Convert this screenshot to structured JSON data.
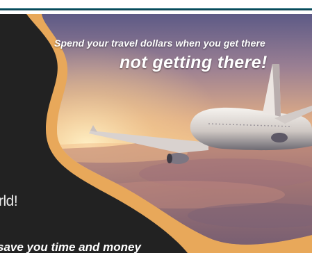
{
  "banner": {
    "headline_line1": "Spend your travel dollars when you get there",
    "headline_line2": "not getting there!",
    "left_text_1": "rld!",
    "left_text_2": "save you time and money",
    "image": "airplane-above-clouds-at-sunset",
    "colors": {
      "background": "#222222",
      "accent_swoosh": "#e8a85a",
      "top_border": "#0a4a5a"
    }
  }
}
